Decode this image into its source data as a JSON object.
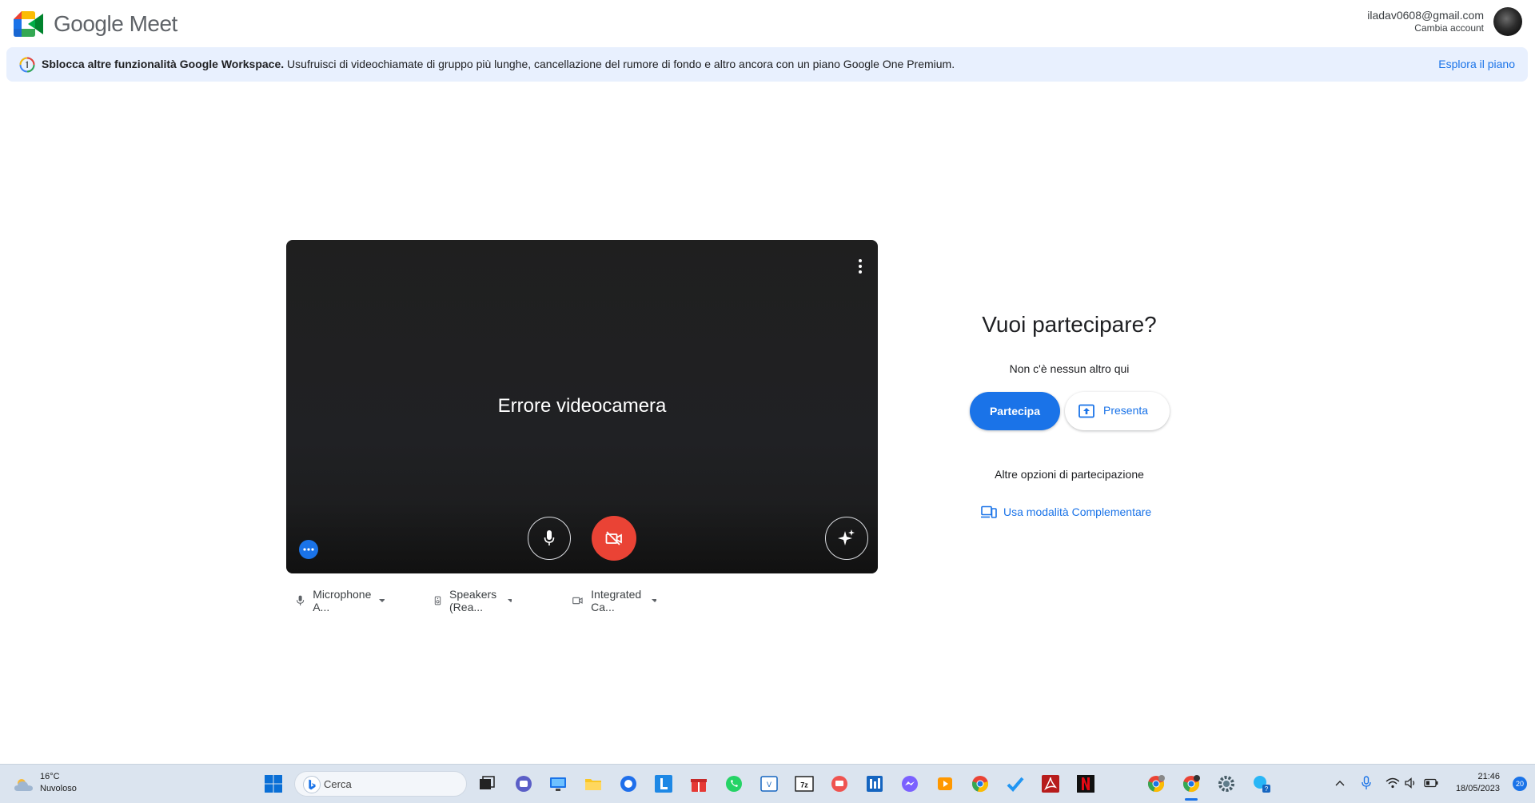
{
  "header": {
    "app_title": "Google Meet",
    "account_email": "iladav0608@gmail.com",
    "switch_account": "Cambia account"
  },
  "banner": {
    "bold_text": "Sblocca altre funzionalità Google Workspace.",
    "text": " Usufruisci di videochiamate di gruppo più lunghe, cancellazione del rumore di fondo e altro ancora con un piano Google One Premium.",
    "link": "Esplora il piano"
  },
  "preview": {
    "message": "Errore videocamera",
    "mic_state": "on",
    "camera_state": "off"
  },
  "devices": {
    "microphone": "Microphone A...",
    "speakers": "Speakers (Rea...",
    "camera": "Integrated Ca..."
  },
  "join": {
    "title": "Vuoi partecipare?",
    "subtitle": "Non c'è nessun altro qui",
    "join_button": "Partecipa",
    "present_button": "Presenta",
    "other_options": "Altre opzioni di partecipazione",
    "companion_mode": "Usa modalità Complementare"
  },
  "taskbar": {
    "weather_temp": "16°C",
    "weather_desc": "Nuvoloso",
    "search_placeholder": "Cerca",
    "time": "21:46",
    "date": "18/05/2023",
    "notifications": "20",
    "apps": [
      "file-explorer-icon",
      "teams-icon",
      "remote-desktop-icon",
      "files-icon",
      "github-icon",
      "l-app-icon",
      "gift-icon",
      "whatsapp-icon",
      "vs-icon",
      "7zip-icon",
      "anydesk-icon",
      "settings-app-icon",
      "messenger-icon",
      "media-icon",
      "chrome-icon",
      "todo-icon",
      "acrobat-icon",
      "netflix-icon"
    ]
  },
  "colors": {
    "accent": "#1a73e8",
    "camera_off": "#ea4335",
    "banner_bg": "#e8f0fe",
    "preview_bg": "#202124"
  }
}
